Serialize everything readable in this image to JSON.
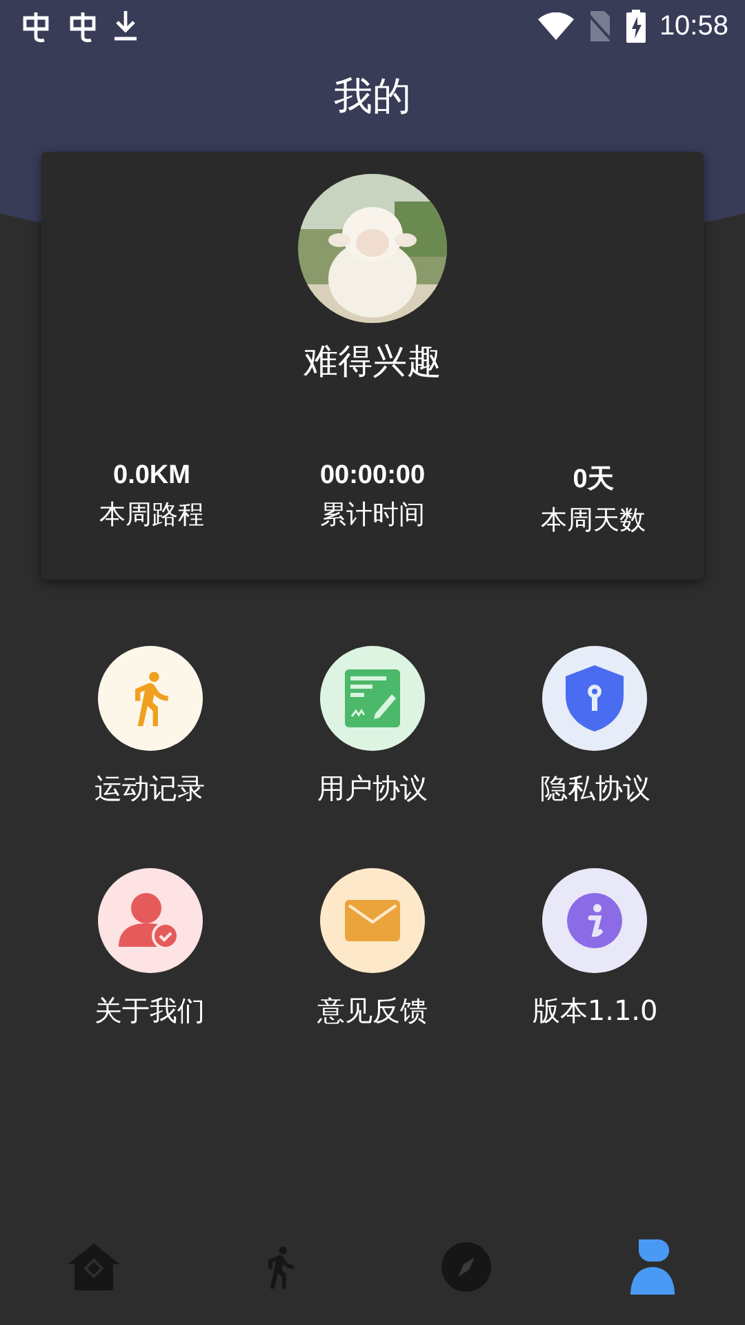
{
  "status_bar": {
    "time": "10:58"
  },
  "title": "我的",
  "profile": {
    "name": "难得兴趣"
  },
  "stats": [
    {
      "value": "0.0KM",
      "label": "本周路程"
    },
    {
      "value": "00:00:00",
      "label": "累计时间"
    },
    {
      "value": "0天",
      "label": "本周天数"
    }
  ],
  "menu": [
    {
      "label": "运动记录"
    },
    {
      "label": "用户协议"
    },
    {
      "label": "隐私协议"
    },
    {
      "label": "关于我们"
    },
    {
      "label": "意见反馈"
    },
    {
      "label": "版本1.1.0"
    }
  ],
  "bottom_nav": [
    {
      "selected": false
    },
    {
      "selected": false
    },
    {
      "selected": false
    },
    {
      "selected": true
    }
  ]
}
